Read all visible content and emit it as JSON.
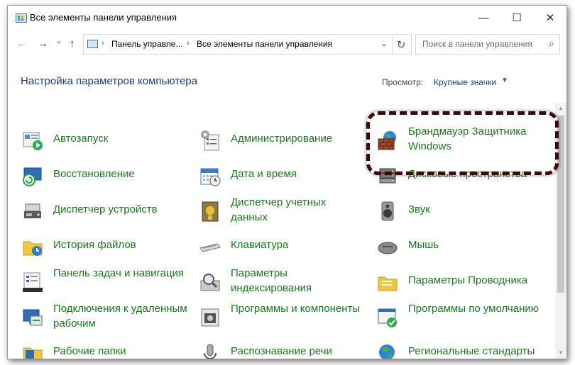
{
  "window": {
    "title": "Все элементы панели управления",
    "controls": {
      "minimize": "—",
      "maximize": "☐",
      "close": "✕"
    }
  },
  "address_bar": {
    "back": "←",
    "forward": "→",
    "dropdown": "⌄",
    "up": "↑",
    "separator": "›",
    "breadcrumbs": [
      "Панель управле...",
      "Все элементы панели управления"
    ],
    "expand_caret": "⌄",
    "refresh": "↻",
    "search_placeholder": "Поиск в панели управления",
    "search_icon": "⌕"
  },
  "header": {
    "title": "Настройка параметров компьютера",
    "view_label": "Просмотр:",
    "view_value": "Крупные значки",
    "view_caret": "▼"
  },
  "scrollbar": {
    "up": "▲",
    "down": "▼"
  },
  "items": [
    {
      "label": "Автозапуск",
      "icon": "autoplay-icon"
    },
    {
      "label": "Администрирование",
      "icon": "administrative-tools-icon"
    },
    {
      "label": "Брандмауэр Защитника Windows",
      "icon": "firewall-icon"
    },
    {
      "label": "Восстановление",
      "icon": "recovery-icon"
    },
    {
      "label": "Дата и время",
      "icon": "calendar-clock-icon"
    },
    {
      "label": "Дисковые пространства",
      "icon": "storage-spaces-icon"
    },
    {
      "label": "Диспетчер устройств",
      "icon": "device-manager-icon"
    },
    {
      "label": "Диспетчер учетных данных",
      "icon": "credential-manager-icon"
    },
    {
      "label": "Звук",
      "icon": "speaker-icon"
    },
    {
      "label": "История файлов",
      "icon": "file-history-icon"
    },
    {
      "label": "Клавиатура",
      "icon": "keyboard-icon"
    },
    {
      "label": "Мышь",
      "icon": "mouse-icon"
    },
    {
      "label": "Панель задач и навигация",
      "icon": "taskbar-icon"
    },
    {
      "label": "Параметры индексирования",
      "icon": "indexing-icon"
    },
    {
      "label": "Параметры Проводника",
      "icon": "explorer-options-icon"
    },
    {
      "label": "Подключения к удаленным рабочим",
      "icon": "remote-desktop-icon"
    },
    {
      "label": "Программы и компоненты",
      "icon": "programs-icon"
    },
    {
      "label": "Программы по умолчанию",
      "icon": "default-programs-icon"
    },
    {
      "label": "Рабочие папки",
      "icon": "work-folders-icon"
    },
    {
      "label": "Распознавание речи",
      "icon": "microphone-icon"
    },
    {
      "label": "Региональные стандарты",
      "icon": "globe-icon"
    }
  ],
  "colors": {
    "item_text": "#1a7a1a",
    "header_text": "#1e3a8a",
    "highlight_border": "#3b0a0a",
    "link_blue": "#1f6fc6"
  }
}
